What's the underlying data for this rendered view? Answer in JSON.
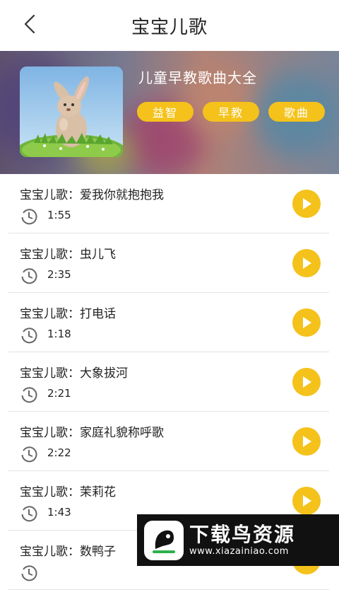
{
  "header": {
    "title": "宝宝儿歌"
  },
  "album": {
    "title": "儿童早教歌曲大全",
    "tags": [
      "益智",
      "早教",
      "歌曲"
    ]
  },
  "songs": [
    {
      "title": "宝宝儿歌：爱我你就抱抱我",
      "duration": "1:55"
    },
    {
      "title": "宝宝儿歌：虫儿飞",
      "duration": "2:35"
    },
    {
      "title": "宝宝儿歌：打电话",
      "duration": "1:18"
    },
    {
      "title": "宝宝儿歌：大象拔河",
      "duration": "2:21"
    },
    {
      "title": "宝宝儿歌：家庭礼貌称呼歌",
      "duration": "2:22"
    },
    {
      "title": "宝宝儿歌：茉莉花",
      "duration": "1:43"
    },
    {
      "title": "宝宝儿歌：数鸭子",
      "duration": ""
    }
  ],
  "watermark": {
    "main": "下载鸟资源",
    "url": "www.xiazainiao.com"
  },
  "colors": {
    "accent": "#f4c21b",
    "divider": "#e3e3e3"
  },
  "icons": {
    "back": "chevron-left-icon",
    "clock": "clock-icon",
    "play": "play-icon"
  }
}
